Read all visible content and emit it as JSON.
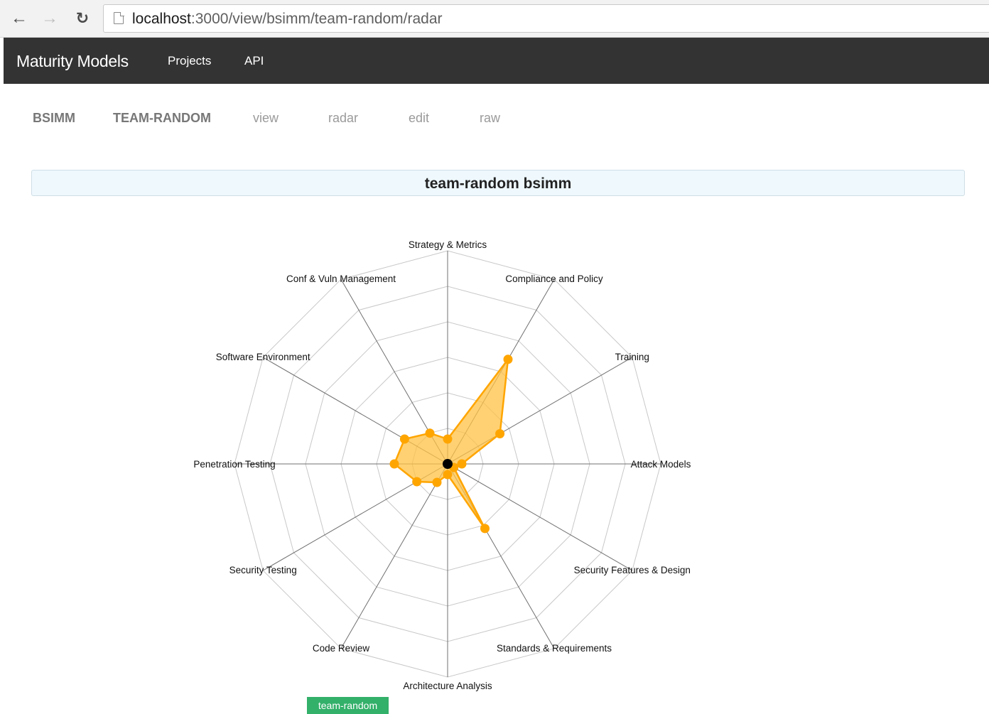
{
  "browser": {
    "url_host": "localhost",
    "url_rest": ":3000/view/bsimm/team-random/radar",
    "icons": {
      "back": "back-arrow-icon",
      "forward": "forward-arrow-icon",
      "reload": "reload-icon",
      "page": "page-icon"
    }
  },
  "navbar": {
    "brand": "Maturity Models",
    "links": [
      {
        "label": "Projects"
      },
      {
        "label": "API"
      }
    ]
  },
  "subnav": {
    "model": "BSIMM",
    "project": "TEAM-RANDOM",
    "links": [
      {
        "label": "view"
      },
      {
        "label": "radar"
      },
      {
        "label": "edit"
      },
      {
        "label": "raw"
      }
    ]
  },
  "panel": {
    "title": "team-random bsimm"
  },
  "legend": {
    "label": "team-random",
    "color": "#33b06a"
  },
  "colors": {
    "series": "#ffa500",
    "series_fill": "#ffc244",
    "center": "#000000",
    "grid": "#c8c8c8",
    "axis": "#707070"
  },
  "chart_data": {
    "type": "radar",
    "axes": [
      "Strategy & Metrics",
      "Compliance and Policy",
      "Training",
      "Attack Models",
      "Security Features & Design",
      "Standards & Requirements",
      "Architecture Analysis",
      "Code Review",
      "Security Testing",
      "Penetration Testing",
      "Software Environment",
      "Conf & Vuln Management"
    ],
    "rings": 6,
    "range": [
      0,
      6
    ],
    "grid": true,
    "series": [
      {
        "name": "team-random",
        "values": [
          0.7,
          3.4,
          1.7,
          0.4,
          0.2,
          2.1,
          0.3,
          0.6,
          1.0,
          1.5,
          1.4,
          1.0
        ]
      }
    ]
  }
}
